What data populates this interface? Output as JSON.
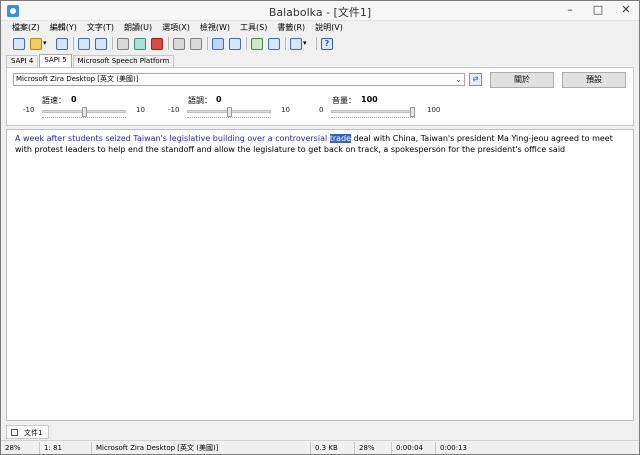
{
  "window": {
    "title": "Balabolka - [文件1]",
    "controls": {
      "minimize": "–",
      "maximize": "□",
      "close": "✕"
    }
  },
  "menu": [
    "檔案(Z)",
    "編輯(Y)",
    "文字(T)",
    "朗讀(U)",
    "選項(X)",
    "檢視(W)",
    "工具(S)",
    "書籤(R)",
    "說明(V)"
  ],
  "toolbar": {
    "icons": [
      "new-document-icon",
      "open-folder-icon",
      "save-icon",
      "save-audio-icon",
      "save-audio-clip-icon",
      "play-icon",
      "pause-icon",
      "stop-icon",
      "split-file-icon",
      "join-file-icon",
      "text-view-icon",
      "bookmark-icon",
      "voice-toggle-icon",
      "book-icon",
      "language-icon",
      "help-icon"
    ]
  },
  "engine_tabs": [
    "SAPI 4",
    "SAPI 5",
    "Microsoft Speech Platform"
  ],
  "selected_engine_tab": "SAPI 5",
  "voice": {
    "selected": "Microsoft Zira Desktop [英文 (美國)]",
    "about_label": "關於",
    "settings_label": "預設"
  },
  "params": [
    {
      "label": "語速：",
      "value": "0",
      "min": "-10",
      "max": "10",
      "level": 0.5
    },
    {
      "label": "語調：",
      "value": "0",
      "min": "-10",
      "max": "10",
      "level": 0.5
    },
    {
      "label": "音量：",
      "value": "100",
      "min": "0",
      "max": "100",
      "level": 1.0
    }
  ],
  "editor": {
    "spoken_text": "A week after students seized Taiwan's legislative building over a controversial ",
    "current_word": "trade",
    "remaining_text": " deal with China, Taiwan's president Ma Ying-jeou agreed to meet with protest leaders to help end the standoff and allow the legislature to get back on track, a spokesperson for the president's office said"
  },
  "document_tab": {
    "label": "文件1",
    "checked": false
  },
  "status": {
    "zoom": "28%",
    "position": "1:  81",
    "voice": "Microsoft Zira Desktop [英文 (美國)]",
    "size": "0.3 KB",
    "progress": "28%",
    "elapsed": "0:00:04",
    "total": "0:00:13"
  },
  "colors": {
    "spoken": "#1e1ee0",
    "highlight": "#3163c5",
    "window_bg": "#f0f0f0"
  }
}
